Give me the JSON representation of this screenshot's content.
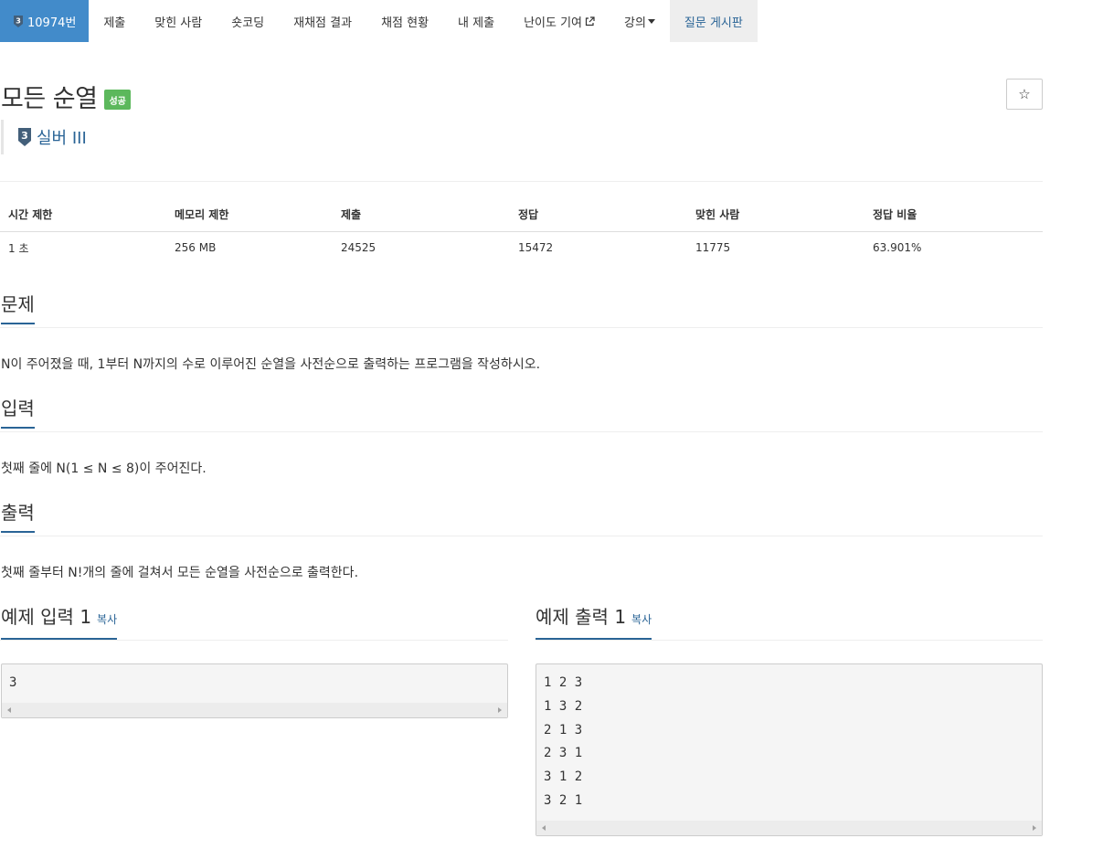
{
  "nav": {
    "problem_id": "10974번",
    "tier_badge_number": "3",
    "items": [
      {
        "label": "제출"
      },
      {
        "label": "맞힌 사람"
      },
      {
        "label": "숏코딩"
      },
      {
        "label": "재채점 결과"
      },
      {
        "label": "채점 현황"
      },
      {
        "label": "내 제출"
      },
      {
        "label": "난이도 기여"
      },
      {
        "label": "강의"
      },
      {
        "label": "질문 게시판"
      }
    ]
  },
  "problem": {
    "title": "모든 순열",
    "status": "성공",
    "star": "☆",
    "tier_number": "3",
    "tier": "실버 III"
  },
  "info": {
    "headers": [
      "시간 제한",
      "메모리 제한",
      "제출",
      "정답",
      "맞힌 사람",
      "정답 비율"
    ],
    "values": [
      "1 초",
      "256 MB",
      "24525",
      "15472",
      "11775",
      "63.901%"
    ]
  },
  "sections": {
    "description_title": "문제",
    "description": "N이 주어졌을 때, 1부터 N까지의 수로 이루어진 순열을 사전순으로 출력하는 프로그램을 작성하시오.",
    "input_title": "입력",
    "input": "첫째 줄에 N(1 ≤ N ≤ 8)이 주어진다.",
    "output_title": "출력",
    "output": "첫째 줄부터 N!개의 줄에 걸쳐서 모든 순열을 사전순으로 출력한다."
  },
  "samples": {
    "input_title": "예제 입력 1",
    "output_title": "예제 출력 1",
    "copy_label": "복사",
    "input_text": "3",
    "output_text": "1 2 3\n1 3 2\n2 1 3\n2 3 1\n3 1 2\n3 2 1"
  },
  "colors": {
    "nav_active": "#428bca",
    "link": "#2a6496",
    "success": "#5cb85c"
  }
}
